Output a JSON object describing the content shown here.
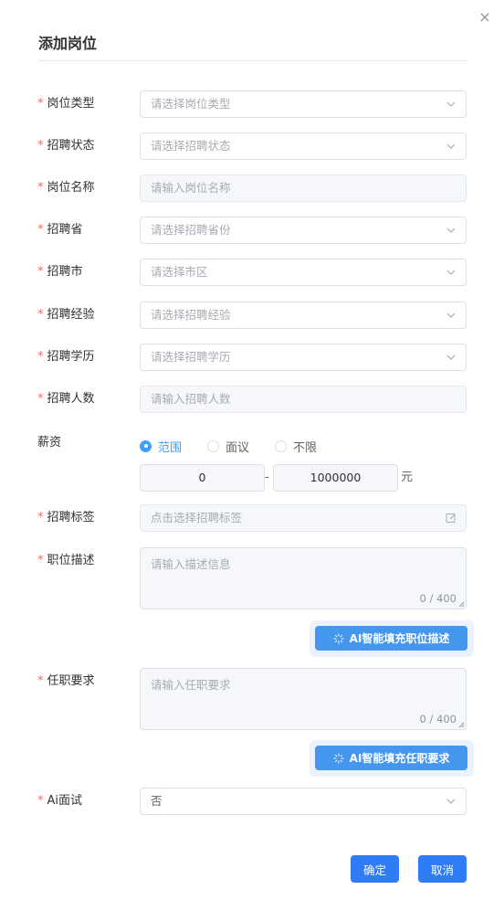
{
  "dialog": {
    "title": "添加岗位",
    "close_icon": "×"
  },
  "required_mark": "*",
  "fields": {
    "post_type": {
      "label": "岗位类型",
      "placeholder": "请选择岗位类型"
    },
    "recruit_status": {
      "label": "招聘状态",
      "placeholder": "请选择招聘状态"
    },
    "post_name": {
      "label": "岗位名称",
      "placeholder": "请输入岗位名称"
    },
    "province": {
      "label": "招聘省",
      "placeholder": "请选择招聘省份"
    },
    "city": {
      "label": "招聘市",
      "placeholder": "请选择市区"
    },
    "experience": {
      "label": "招聘经验",
      "placeholder": "请选择招聘经验"
    },
    "education": {
      "label": "招聘学历",
      "placeholder": "请选择招聘学历"
    },
    "headcount": {
      "label": "招聘人数",
      "placeholder": "请输入招聘人数"
    },
    "salary": {
      "label": "薪资",
      "options": [
        "范围",
        "面议",
        "不限"
      ],
      "selected": "范围",
      "min": "0",
      "separator": "-",
      "max": "1000000",
      "unit": "元"
    },
    "tags": {
      "label": "招聘标签",
      "placeholder": "点击选择招聘标签"
    },
    "description": {
      "label": "职位描述",
      "placeholder": "请输入描述信息",
      "counter": "0 / 400"
    },
    "requirements": {
      "label": "任职要求",
      "placeholder": "请输入任职要求",
      "counter": "0 / 400"
    },
    "ai_interview": {
      "label": "Ai面试",
      "value": "否"
    }
  },
  "ai_buttons": {
    "fill_description": "AI智能填充职位描述",
    "fill_requirements": "AI智能填充任职要求"
  },
  "footer": {
    "confirm": "确定",
    "cancel": "取消"
  },
  "colors": {
    "primary": "#409eff",
    "button": "#2f7cf6",
    "required": "#f56c6c"
  }
}
